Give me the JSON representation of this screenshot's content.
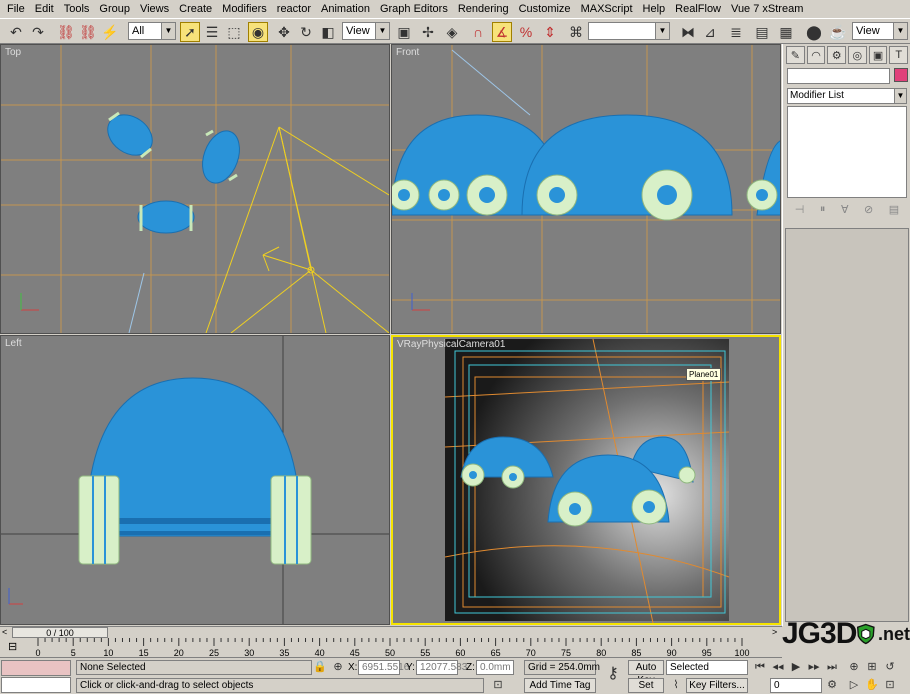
{
  "menu": [
    "File",
    "Edit",
    "Tools",
    "Group",
    "Views",
    "Create",
    "Modifiers",
    "reactor",
    "Animation",
    "Graph Editors",
    "Rendering",
    "Customize",
    "MAXScript",
    "Help",
    "RealFlow",
    "Vue 7 xStream"
  ],
  "toolbar": {
    "selection_filter": "All",
    "ref_coord": "View",
    "named_selection": "",
    "render_view": "View"
  },
  "viewports": {
    "top_label": "Top",
    "front_label": "Front",
    "left_label": "Left",
    "camera_label": "VRayPhysicalCamera01",
    "camera_tag": "Plane01"
  },
  "command_panel": {
    "modifier_list": "Modifier List",
    "object_color": "#e0407a"
  },
  "timeslider": {
    "frame": "0 / 100"
  },
  "trackbar": {
    "ticks": [
      "0",
      "5",
      "10",
      "15",
      "20",
      "25",
      "30",
      "35",
      "40",
      "45",
      "50",
      "55",
      "60",
      "65",
      "70",
      "75",
      "80",
      "85",
      "90",
      "95",
      "100"
    ]
  },
  "status": {
    "selection": "None Selected",
    "prompt": "Click or click-and-drag to select objects",
    "x_label": "X:",
    "x_value": "6951.5516",
    "y_label": "Y:",
    "y_value": "12077.583",
    "z_label": "Z:",
    "z_value": "0.0mm",
    "grid": "Grid = 254.0mm",
    "add_time_tag": "Add Time Tag",
    "auto_key": "Auto Key",
    "set_key": "Set Key",
    "key_mode": "Selected",
    "key_filters": "Key Filters...",
    "current_frame": "0"
  },
  "logo": {
    "main": "JG3D",
    "suffix": ".net"
  },
  "colors": {
    "wire": "#1e8fd8",
    "wheel": "#d8f0c8",
    "grid": "#e0a040",
    "camera": "#f0d020",
    "active_border": "#f5e300"
  }
}
